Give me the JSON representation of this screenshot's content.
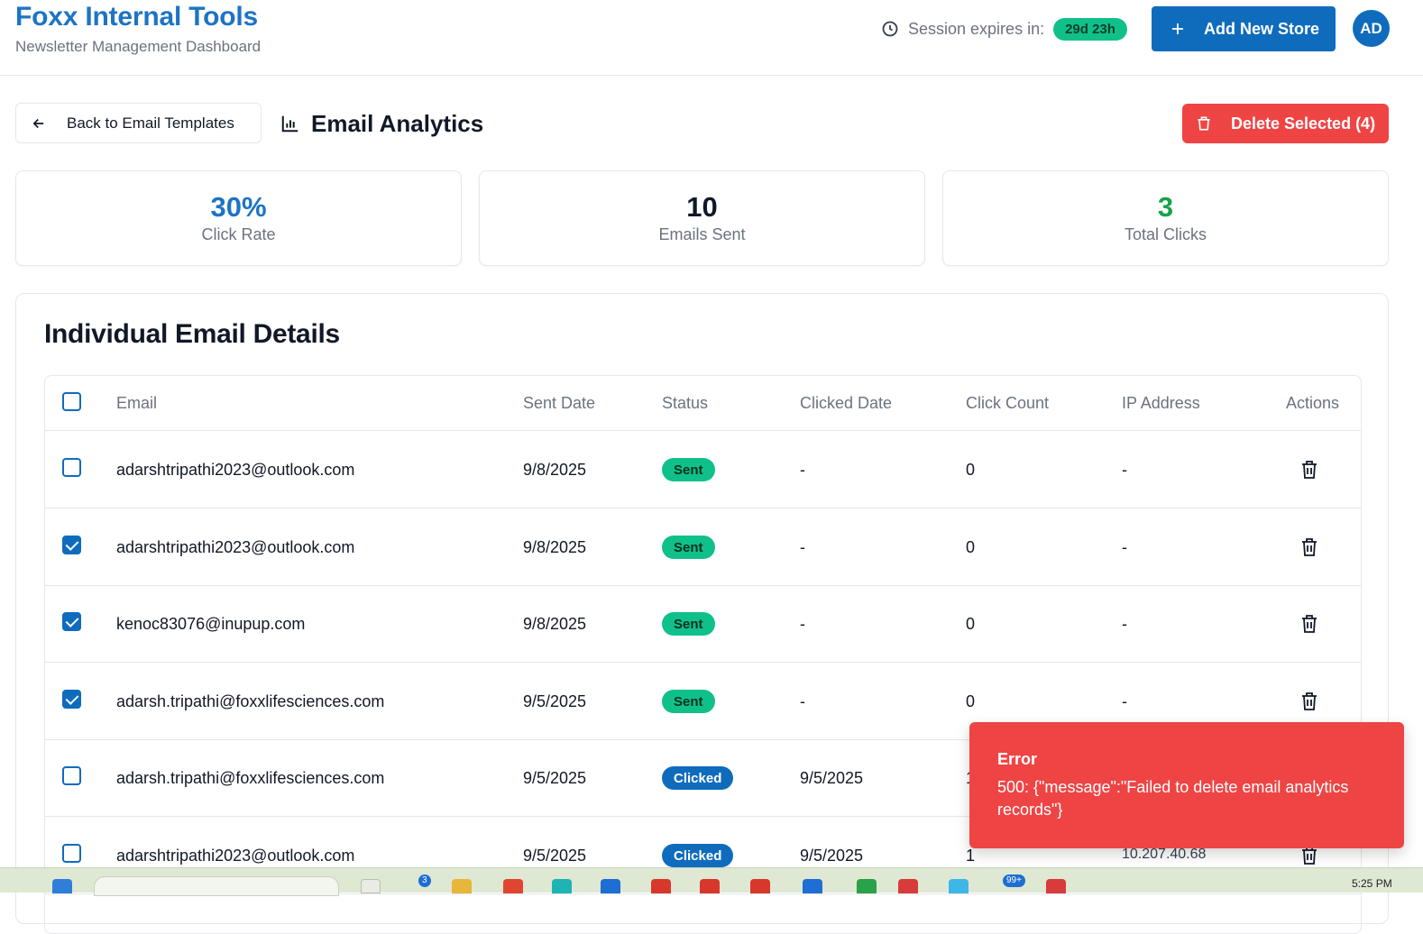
{
  "header": {
    "app_title": "Foxx Internal Tools",
    "app_subtitle": "Newsletter Management Dashboard",
    "session_label": "Session expires in:",
    "session_value": "29d 23h",
    "add_store_label": "Add New Store",
    "avatar_initials": "AD"
  },
  "toolbar": {
    "back_label": "Back to Email Templates",
    "page_title": "Email Analytics",
    "delete_selected_label": "Delete Selected (4)"
  },
  "stats": [
    {
      "value": "30%",
      "label": "Click Rate",
      "color": "#1d74c4"
    },
    {
      "value": "10",
      "label": "Emails Sent",
      "color": "#111827"
    },
    {
      "value": "3",
      "label": "Total Clicks",
      "color": "#16a34a"
    }
  ],
  "details": {
    "title": "Individual Email Details",
    "columns": [
      "Email",
      "Sent Date",
      "Status",
      "Clicked Date",
      "Click Count",
      "IP Address",
      "Actions"
    ],
    "rows": [
      {
        "checked": false,
        "email": "adarshtripathi2023@outlook.com",
        "sent_date": "9/8/2025",
        "status": "Sent",
        "clicked_date": "-",
        "click_count": "0",
        "ip": "-"
      },
      {
        "checked": true,
        "email": "adarshtripathi2023@outlook.com",
        "sent_date": "9/8/2025",
        "status": "Sent",
        "clicked_date": "-",
        "click_count": "0",
        "ip": "-"
      },
      {
        "checked": true,
        "email": "kenoc83076@inupup.com",
        "sent_date": "9/8/2025",
        "status": "Sent",
        "clicked_date": "-",
        "click_count": "0",
        "ip": "-"
      },
      {
        "checked": true,
        "email": "adarsh.tripathi@foxxlifesciences.com",
        "sent_date": "9/5/2025",
        "status": "Sent",
        "clicked_date": "-",
        "click_count": "0",
        "ip": "-"
      },
      {
        "checked": false,
        "email": "adarsh.tripathi@foxxlifesciences.com",
        "sent_date": "9/5/2025",
        "status": "Clicked",
        "clicked_date": "9/5/2025",
        "click_count": "1",
        "ip": ""
      },
      {
        "checked": false,
        "email": "adarshtripathi2023@outlook.com",
        "sent_date": "9/5/2025",
        "status": "Clicked",
        "clicked_date": "9/5/2025",
        "click_count": "1",
        "ip": "10.207.40.68"
      }
    ]
  },
  "toast": {
    "title": "Error",
    "message": "500: {\"message\":\"Failed to delete email analytics records\"}"
  },
  "taskbar": {
    "time": "5:25 PM",
    "badge_a": "3",
    "badge_b": "99+"
  }
}
